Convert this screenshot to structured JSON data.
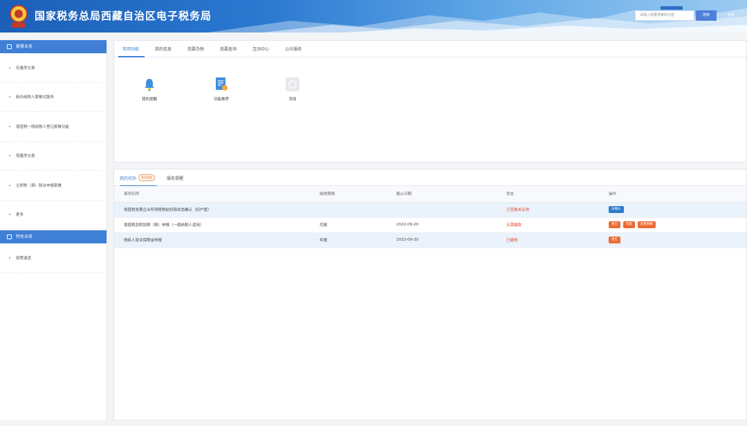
{
  "header": {
    "site_title": "国家税务总局西藏自治区电子税务局",
    "search_placeholder": "请输入需要搜索的内容",
    "search_button": "搜索",
    "welcome": "欢迎"
  },
  "sidebar": {
    "section1_title": "套餐业务",
    "section1_items": [
      "存量房交易",
      "新办纳税人套餐式服务",
      "增值税一般纳税人登记套餐功能",
      "增量房交易",
      "主附税（费）联合申报套餐",
      "更多"
    ],
    "section2_title": "特色业务",
    "section2_items": [
      "政策速递"
    ]
  },
  "top_panel": {
    "tabs": [
      "常用功能",
      "我的信息",
      "我要办税",
      "我要查询",
      "互动中心",
      "公众服务"
    ],
    "functions": [
      "我的提醒",
      "功能推荐",
      "添加"
    ]
  },
  "bottom_panel": {
    "tabs": [
      "我的待办",
      "服务提醒"
    ],
    "badge": "简体套餐",
    "columns": [
      "事项名称",
      "纳税期限",
      "截止日期",
      "状态",
      "操作"
    ],
    "rows": [
      {
        "name": "增值税发票企业所得税税前扣除状态确认（扣户管）",
        "period": "",
        "deadline": "",
        "status": "已查看未反馈",
        "actions": [
          "去确认"
        ]
      },
      {
        "name": "增值税及附加税（费）申报（一般纳税人适用）",
        "period": "月报",
        "deadline": "2022-09-20",
        "status": "无需缴款",
        "actions": [
          "更正",
          "作废",
          "查看明细"
        ]
      },
      {
        "name": "残疾人就业保障金申报",
        "period": "年报",
        "deadline": "2022-09-30",
        "status": "已缴税",
        "actions": [
          "更正"
        ]
      }
    ]
  },
  "colors": {
    "primary": "#3f7fd6",
    "orange": "#ec6b34",
    "status_red": "#e04b3c",
    "action_blue": "#2c7bc9"
  }
}
